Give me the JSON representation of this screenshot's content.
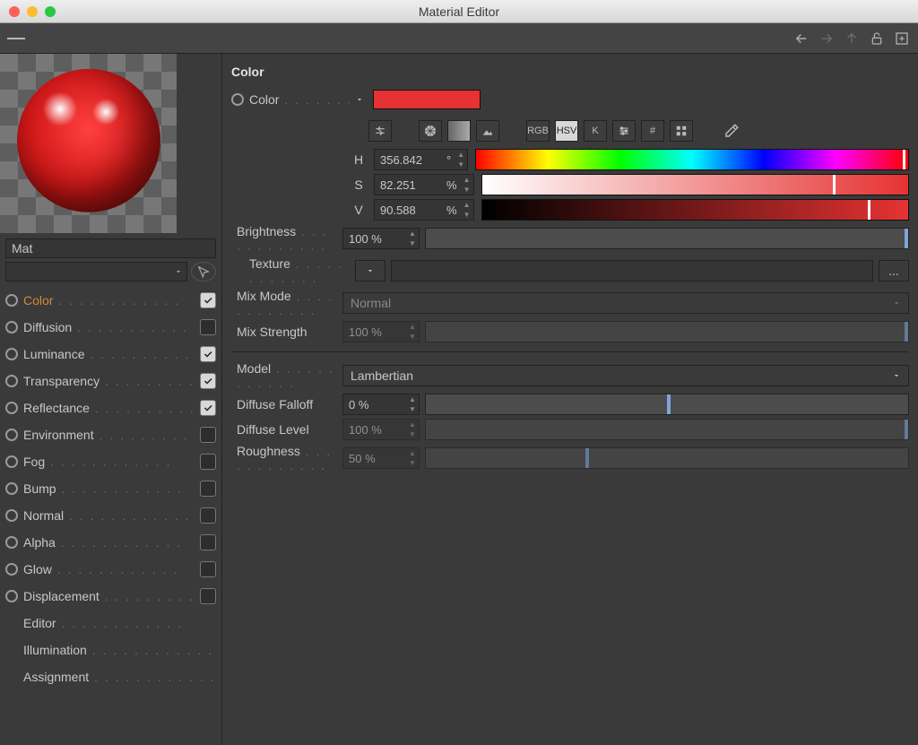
{
  "window": {
    "title": "Material Editor"
  },
  "material_name": "Mat",
  "channels": [
    {
      "id": "color",
      "label": "Color",
      "checked": true,
      "hasCheck": true,
      "active": true
    },
    {
      "id": "diffusion",
      "label": "Diffusion",
      "checked": false,
      "hasCheck": true,
      "active": false
    },
    {
      "id": "luminance",
      "label": "Luminance",
      "checked": true,
      "hasCheck": true,
      "active": false
    },
    {
      "id": "transparency",
      "label": "Transparency",
      "checked": true,
      "hasCheck": true,
      "active": false
    },
    {
      "id": "reflectance",
      "label": "Reflectance",
      "checked": true,
      "hasCheck": true,
      "active": false
    },
    {
      "id": "environment",
      "label": "Environment",
      "checked": false,
      "hasCheck": true,
      "active": false
    },
    {
      "id": "fog",
      "label": "Fog",
      "checked": false,
      "hasCheck": true,
      "active": false
    },
    {
      "id": "bump",
      "label": "Bump",
      "checked": false,
      "hasCheck": true,
      "active": false
    },
    {
      "id": "normal",
      "label": "Normal",
      "checked": false,
      "hasCheck": true,
      "active": false
    },
    {
      "id": "alpha",
      "label": "Alpha",
      "checked": false,
      "hasCheck": true,
      "active": false
    },
    {
      "id": "glow",
      "label": "Glow",
      "checked": false,
      "hasCheck": true,
      "active": false
    },
    {
      "id": "displacement",
      "label": "Displacement",
      "checked": false,
      "hasCheck": true,
      "active": false
    },
    {
      "id": "editor",
      "label": "Editor",
      "checked": false,
      "hasCheck": false,
      "active": false
    },
    {
      "id": "illumination",
      "label": "Illumination",
      "checked": false,
      "hasCheck": false,
      "active": false
    },
    {
      "id": "assignment",
      "label": "Assignment",
      "checked": false,
      "hasCheck": false,
      "active": false
    }
  ],
  "section": {
    "title": "Color"
  },
  "color": {
    "label": "Color",
    "swatch_hex": "#e63232",
    "mode_buttons": [
      "RGB",
      "HSV",
      "K"
    ],
    "active_mode": "HSV",
    "h": {
      "label": "H",
      "value": "356.842",
      "unit": "°",
      "handle_pct": 98.7
    },
    "s": {
      "label": "S",
      "value": "82.251",
      "unit": "%",
      "handle_pct": 82.3
    },
    "v": {
      "label": "V",
      "value": "90.588",
      "unit": "%",
      "handle_pct": 90.6
    }
  },
  "brightness": {
    "label": "Brightness",
    "value": "100 %",
    "slider_pct": 100
  },
  "texture": {
    "label": "Texture",
    "value": "",
    "ellipsis": "..."
  },
  "mixmode": {
    "label": "Mix Mode",
    "value": "Normal",
    "enabled": false
  },
  "mixstr": {
    "label": "Mix Strength",
    "value": "100 %",
    "enabled": false,
    "slider_pct": 100
  },
  "model": {
    "label": "Model",
    "value": "Lambertian"
  },
  "dfalloff": {
    "label": "Diffuse Falloff",
    "value": "0 %",
    "slider_pct": 50
  },
  "dlevel": {
    "label": "Diffuse Level",
    "value": "100 %",
    "enabled": false,
    "slider_pct": 100
  },
  "rough": {
    "label": "Roughness",
    "value": "50 %",
    "enabled": false,
    "slider_pct": 33
  }
}
